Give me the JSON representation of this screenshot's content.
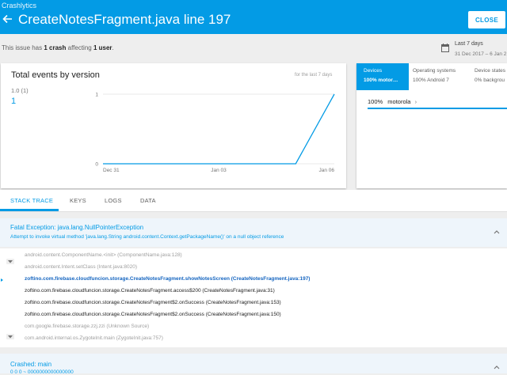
{
  "app": {
    "name": "Crashlytics"
  },
  "header": {
    "title": "CreateNotesFragment.java line 197",
    "close_label": "CLOSE"
  },
  "summary": {
    "prefix": "This issue has ",
    "crashes": "1 crash",
    "middle": " affecting ",
    "users": "1 user",
    "suffix": "."
  },
  "date_filter": {
    "title": "Last 7 days",
    "range": "31 Dec 2017 – 6 Jan 2"
  },
  "events_card": {
    "title": "Total events by version",
    "period": "for the last 7 days",
    "version_label": "1.0 (1)",
    "version_count": "1"
  },
  "chart_data": {
    "type": "line",
    "x": [
      "Dec 31",
      "Jan 01",
      "Jan 02",
      "Jan 03",
      "Jan 04",
      "Jan 05",
      "Jan 06"
    ],
    "x_tick_labels": [
      "Dec 31",
      "Jan 03",
      "Jan 06"
    ],
    "series": [
      {
        "values": [
          0,
          0,
          0,
          0,
          0,
          0,
          1
        ]
      }
    ],
    "ylim": [
      0,
      1
    ],
    "y_ticks": [
      "0",
      "1"
    ],
    "grid": true,
    "color": "#039be5"
  },
  "device_card": {
    "tabs": [
      {
        "heading": "Devices",
        "value": "100% motor…"
      },
      {
        "heading": "Operating systems",
        "value": "100% Android 7"
      },
      {
        "heading": "Device states",
        "value": "0% backgrou"
      }
    ],
    "row_percent": "100%",
    "row_name": "motorola",
    "row_arrow": "›"
  },
  "tabs": [
    "STACK TRACE",
    "KEYS",
    "LOGS",
    "DATA"
  ],
  "exception": {
    "title": "Fatal Exception: java.lang.NullPointerException",
    "message": "Attempt to invoke virtual method 'java.lang.String android.content.Context.getPackageName()' on a null object reference"
  },
  "frames": [
    "android.content.ComponentName.<init> (ComponentName.java:128)",
    "android.content.Intent.setClass (Intent.java:8020)",
    "zoftino.com.firebase.cloudfuncion.storage.CreateNotesFragment.showNotesScreen (CreateNotesFragment.java:197)",
    "zoftino.com.firebase.cloudfuncion.storage.CreateNotesFragment.access$200 (CreateNotesFragment.java:31)",
    "zoftino.com.firebase.cloudfuncion.storage.CreateNotesFragment$2.onSuccess (CreateNotesFragment.java:153)",
    "zoftino.com.firebase.cloudfuncion.storage.CreateNotesFragment$2.onSuccess (CreateNotesFragment.java:150)",
    "com.google.firebase.storage.zzj.zzi (Unknown Source)",
    "com.android.internal.os.ZygoteInit.main (ZygoteInit.java:757)"
  ],
  "crashed_thread": {
    "title": "Crashed: main",
    "message": "0 0 0 ~ 0000000000000000"
  },
  "colors": {
    "accent": "#039be5",
    "link": "#1565c0",
    "muted": "#9e9e9e"
  }
}
